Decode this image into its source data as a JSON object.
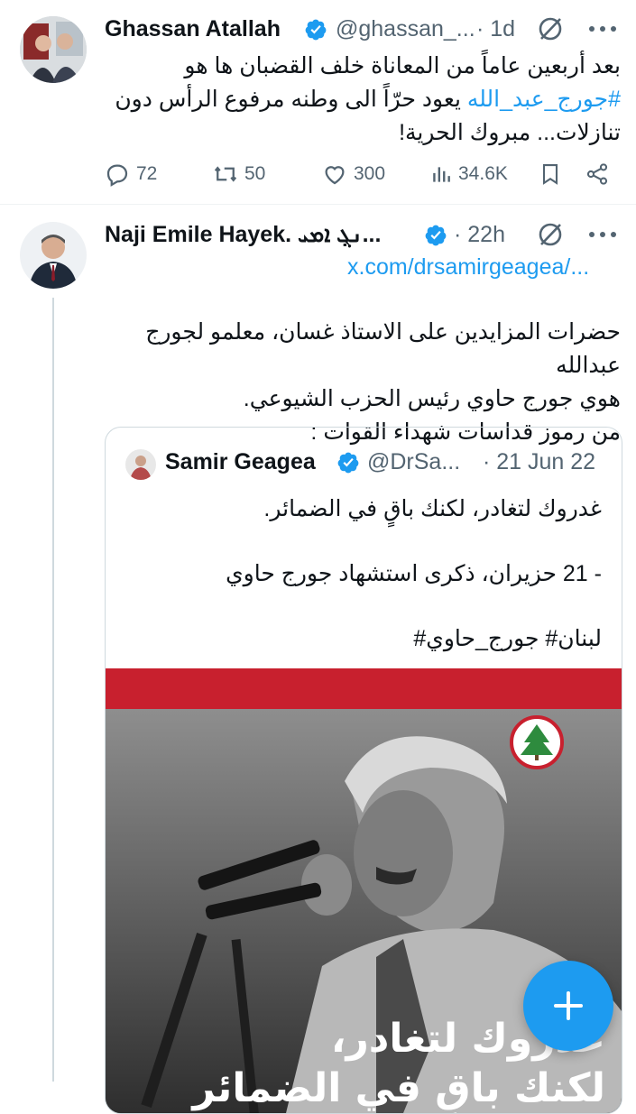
{
  "tweet1": {
    "name": "Ghassan Atallah",
    "handle": "@ghassan_...",
    "time": "· 1d",
    "line1": "بعد أربعين عاماً من المعاناة خلف القضبان ها هو",
    "hashtag": "#جورج_عبد_الله",
    "line2_rest": " يعود حرّاً الى وطنه مرفوع الرأس دون",
    "line3": "تنازلات... مبروك الحرية!",
    "replies": "72",
    "reposts": "50",
    "likes": "300",
    "views": "34.6K"
  },
  "tweet2": {
    "name": "Naji Emile Hayek. ܢܓ݂ ܐܡܝ...",
    "time": "· 22h",
    "link": "x.com/drsamirgeagea/...",
    "line1": "حضرات المزايدين على الاستاذ غسان، معلمو لجورج عبدالله",
    "line2": "هوي جورج حاوي رئيس الحزب الشيوعي.",
    "line3": "من رموز قداسات شهداء القوات :"
  },
  "quote": {
    "name": "Samir Geagea",
    "handle": "@DrSa...",
    "time": "· 21 Jun 22",
    "line1": "غدروك لتغادر، لكنك باقٍ في الضمائر.",
    "line2": "- 21 حزيران، ذكرى استشهاد جورج حاوي",
    "line3": "لبنان# جورج_حاوي#",
    "image_caption1": "غدروك لتغادر،",
    "image_caption2": "لكنك باقٍ في الضمائر"
  },
  "colors": {
    "accent": "#1d9bf0",
    "banner_red": "#c8202e",
    "muted": "#536471"
  }
}
